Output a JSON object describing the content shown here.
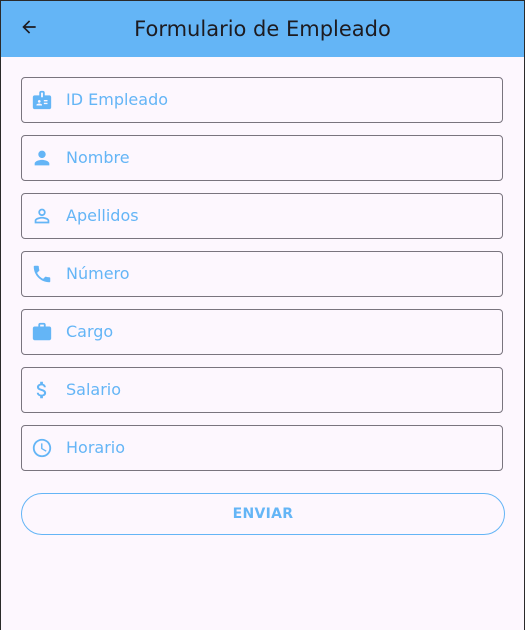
{
  "app_bar": {
    "title": "Formulario de Empleado",
    "back_icon": "arrow-back-icon",
    "background": "#64b5f6"
  },
  "form": {
    "fields": [
      {
        "icon": "badge-icon",
        "placeholder": "ID Empleado"
      },
      {
        "icon": "person-icon",
        "placeholder": "Nombre"
      },
      {
        "icon": "person-outline-icon",
        "placeholder": "Apellidos"
      },
      {
        "icon": "phone-icon",
        "placeholder": "Número"
      },
      {
        "icon": "briefcase-icon",
        "placeholder": "Cargo"
      },
      {
        "icon": "dollar-icon",
        "placeholder": "Salario"
      },
      {
        "icon": "clock-icon",
        "placeholder": "Horario"
      }
    ],
    "submit_label": "ENVIAR"
  },
  "colors": {
    "accent": "#64b5f6",
    "field_border": "#79747e",
    "background": "#fdf7fe",
    "title_text": "#1d1b20"
  }
}
